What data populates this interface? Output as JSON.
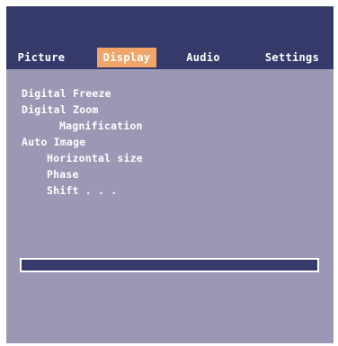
{
  "tabs": [
    {
      "label": "Picture",
      "active": false
    },
    {
      "label": "Display",
      "active": true
    },
    {
      "label": "Audio",
      "active": false
    },
    {
      "label": "Settings",
      "active": false
    }
  ],
  "menu": [
    {
      "label": "Digital Freeze",
      "level": 1
    },
    {
      "label": "Digital Zoom",
      "level": 1
    },
    {
      "label": "Magnification",
      "level": 3
    },
    {
      "label": "Auto Image",
      "level": 1
    },
    {
      "label": "Horizontal size",
      "level": 2
    },
    {
      "label": "Phase",
      "level": 2
    },
    {
      "label": "Shift . . .",
      "level": 2
    }
  ],
  "colors": {
    "header": "#353a6a",
    "panel": "#9a98b4",
    "active_tab": "#f0a66a",
    "text": "#ffffff"
  }
}
